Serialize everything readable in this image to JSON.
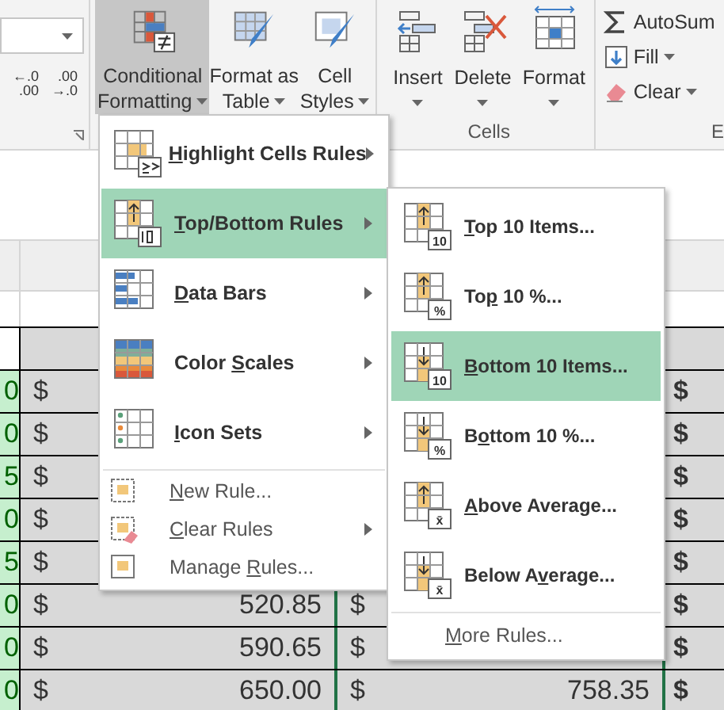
{
  "ribbon": {
    "decimal_buttons": [
      {
        "top": "←.0",
        "bottom": ".00"
      },
      {
        "top": ".00",
        "bottom": "→.0"
      }
    ],
    "styles_group": [
      {
        "line1": "Conditional",
        "line2": "Formatting",
        "selected": true,
        "kind": "conditional"
      },
      {
        "line1": "Format as",
        "line2": "Table",
        "selected": false,
        "kind": "table"
      },
      {
        "line1": "Cell",
        "line2": "Styles",
        "selected": false,
        "kind": "styles"
      }
    ],
    "cells_group": {
      "label": "Cells",
      "buttons": [
        {
          "label": "Insert",
          "kind": "insert"
        },
        {
          "label": "Delete",
          "kind": "delete"
        },
        {
          "label": "Format",
          "kind": "format"
        }
      ]
    },
    "editing_group": {
      "label": "E",
      "buttons": [
        {
          "label": "AutoSum",
          "kind": "sum"
        },
        {
          "label": "Fill",
          "kind": "fill"
        },
        {
          "label": "Clear",
          "kind": "clear"
        }
      ]
    }
  },
  "sheet": {
    "rows": [
      {
        "a": "0",
        "b_sign": "$",
        "d_sign": "$"
      },
      {
        "a": "0",
        "b_sign": "$",
        "d_sign": "$"
      },
      {
        "a": "5",
        "b_sign": "$",
        "d_sign": "$"
      },
      {
        "a": "0",
        "b_sign": "$",
        "d_sign": "$"
      },
      {
        "a": "5",
        "b_sign": "$",
        "d_sign": "$"
      },
      {
        "a": "0",
        "b_sign": "$",
        "b_value": "520.85",
        "c_sign": "$",
        "d_sign": "$"
      },
      {
        "a": "0",
        "b_sign": "$",
        "b_value": "590.65",
        "c_sign": "$",
        "d_sign": "$"
      },
      {
        "a": "0",
        "b_sign": "$",
        "b_value": "650.00",
        "c_sign": "$",
        "c_value": "758.35",
        "d_sign": "$"
      }
    ]
  },
  "menu": {
    "items": [
      {
        "kind": "large",
        "key": "H",
        "after": "ighlight Cells Rules",
        "submenu": true,
        "selected": false
      },
      {
        "kind": "large",
        "key": "T",
        "after": "op/Bottom Rules",
        "submenu": true,
        "selected": true
      },
      {
        "kind": "large",
        "key": "D",
        "after": "ata Bars",
        "submenu": true,
        "selected": false
      },
      {
        "kind": "large",
        "before": "Color ",
        "key": "S",
        "after": "cales",
        "submenu": true,
        "selected": false
      },
      {
        "kind": "large",
        "key": "I",
        "after": "con Sets",
        "submenu": true,
        "selected": false
      },
      {
        "kind": "small",
        "key": "N",
        "after": "ew Rule...",
        "submenu": false,
        "selected": false
      },
      {
        "kind": "small",
        "key": "C",
        "after": "lear Rules",
        "submenu": true,
        "selected": false
      },
      {
        "kind": "small",
        "before": "Manage ",
        "key": "R",
        "after": "ules...",
        "submenu": false,
        "selected": false
      }
    ]
  },
  "submenu": {
    "items": [
      {
        "kind": "large",
        "badge": "10",
        "key": "T",
        "after": "op 10 Items...",
        "selected": false
      },
      {
        "kind": "large",
        "badge": "%",
        "before": "To",
        "key": "p",
        "after": " 10 %...",
        "selected": false
      },
      {
        "kind": "large",
        "badge": "10",
        "key": "B",
        "after": "ottom 10 Items...",
        "selected": true
      },
      {
        "kind": "large",
        "badge": "%",
        "before": "B",
        "key": "o",
        "after": "ttom 10 %...",
        "selected": false
      },
      {
        "kind": "large",
        "badge": "x̄",
        "key": "A",
        "after": "bove Average...",
        "selected": false
      },
      {
        "kind": "large",
        "badge": "x̄",
        "before": "Below A",
        "key": "v",
        "after": "erage...",
        "selected": false
      },
      {
        "kind": "small",
        "key": "M",
        "after": "ore Rules...",
        "selected": false
      }
    ]
  }
}
